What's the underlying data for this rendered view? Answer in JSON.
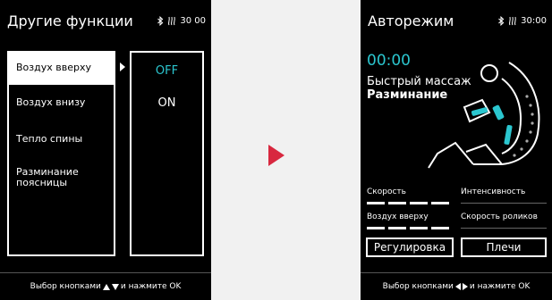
{
  "left_screen": {
    "title": "Другие функции",
    "timer": "30 00",
    "menu_items": [
      {
        "label": "Воздух вверху",
        "selected": true
      },
      {
        "label": "Воздух внизу",
        "selected": false
      },
      {
        "label": "Тепло спины",
        "selected": false
      },
      {
        "label": "Разминание поясницы",
        "selected": false
      }
    ],
    "options": [
      {
        "label": "OFF",
        "selected": true
      },
      {
        "label": "ON",
        "selected": false
      }
    ],
    "footer": {
      "prefix": "Выбор кнопками",
      "suffix": "и нажмите OK"
    }
  },
  "right_screen": {
    "title": "Авторежим",
    "timer": "30:00",
    "elapsed": "00:00",
    "mode_line1": "Быстрый массаж",
    "mode_line2": "Разминание",
    "speed_label": "Скорость",
    "speed_level": 4,
    "intensity_label": "Интенсивность",
    "intensity_level": 0,
    "air_label": "Воздух вверху",
    "air_level": 4,
    "roller_label": "Скорость роликов",
    "roller_level": 0,
    "adjust_button": "Регулировка",
    "shoulders_button": "Плечи",
    "footer": {
      "prefix": "Выбор кнопками",
      "suffix": "и нажмите OK"
    }
  },
  "colors": {
    "accent": "#2bc6cf",
    "arrow": "#d8283f",
    "background": "#f1f1f1",
    "screen": "#000000"
  },
  "icons": [
    "bluetooth-icon",
    "heat-icon",
    "massage-chair-icon"
  ]
}
